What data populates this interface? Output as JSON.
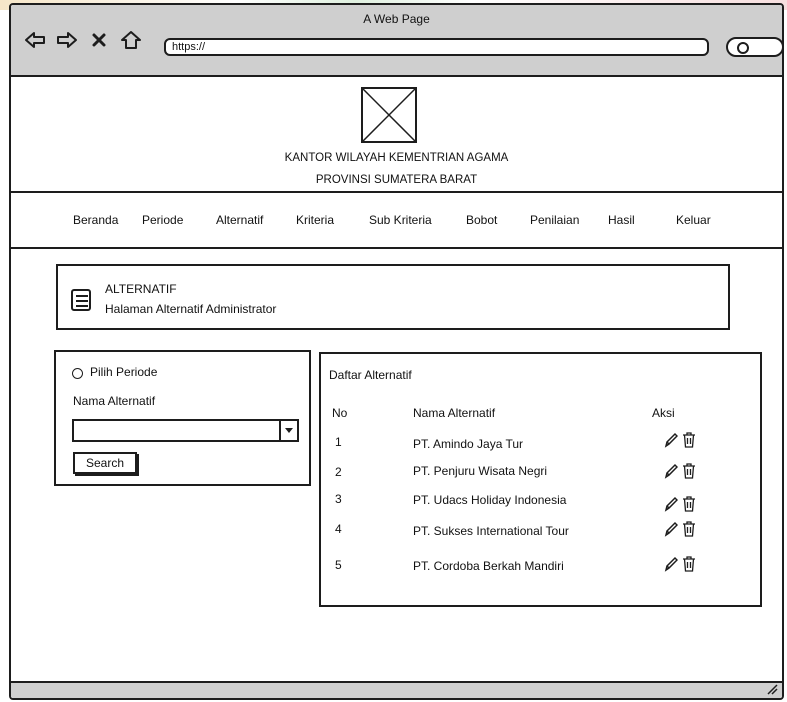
{
  "browser": {
    "title": "A Web Page",
    "url": "https://"
  },
  "header": {
    "org_line1": "KANTOR WILAYAH KEMENTRIAN AGAMA",
    "org_line2": "PROVINSI SUMATERA BARAT"
  },
  "nav": {
    "items": [
      {
        "label": "Beranda"
      },
      {
        "label": "Periode"
      },
      {
        "label": "Alternatif"
      },
      {
        "label": "Kriteria"
      },
      {
        "label": "Sub Kriteria"
      },
      {
        "label": "Bobot"
      },
      {
        "label": "Penilaian"
      },
      {
        "label": "Hasil"
      },
      {
        "label": "Keluar"
      }
    ]
  },
  "page_header": {
    "title": "ALTERNATIF",
    "subtitle": "Halaman Alternatif Administrator"
  },
  "filter": {
    "radio_label": "Pilih Periode",
    "field_label": "Nama Alternatif",
    "select_value": "",
    "search_button": "Search"
  },
  "table": {
    "title": "Daftar Alternatif",
    "headers": {
      "no": "No",
      "name": "Nama Alternatif",
      "action": "Aksi"
    },
    "rows": [
      {
        "no": "1",
        "name": "PT. Amindo Jaya Tur"
      },
      {
        "no": "2",
        "name": "PT. Penjuru Wisata Negri"
      },
      {
        "no": "3",
        "name": "PT. Udacs Holiday Indonesia"
      },
      {
        "no": "4",
        "name": "PT. Sukses International Tour"
      },
      {
        "no": "5",
        "name": "PT. Cordoba Berkah Mandiri"
      }
    ]
  }
}
